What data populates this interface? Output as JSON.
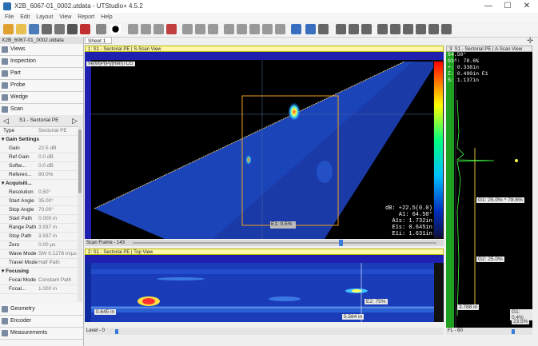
{
  "window": {
    "title": "X2B_6067-01_0002.utdata - UTStudio+ 4.5.2",
    "minimize": "—",
    "maximize": "☐",
    "close": "✕"
  },
  "menu": [
    "File",
    "Edit",
    "Layout",
    "View",
    "Report",
    "Help"
  ],
  "left": {
    "file": "X2B_6067-01_0002.utdata",
    "nav_top": [
      "Views",
      "Inspection",
      "Part",
      "Probe",
      "Wedge",
      "Scan"
    ],
    "selector": "S1 - Sectorial PE",
    "type_key": "Type",
    "type_val": "Sectorial PE",
    "groups": {
      "gain": "Gain Settings",
      "acq": "Acquisiti...",
      "focus": "Focusing"
    },
    "gain_rows": [
      {
        "k": "Gain",
        "v": "22.5 dB"
      },
      {
        "k": "Ref Gain",
        "v": "0.0 dB"
      },
      {
        "k": "Softw...",
        "v": "0.0 dB"
      },
      {
        "k": "Referen...",
        "v": "80.0%"
      }
    ],
    "acq_rows": [
      {
        "k": "Resolution",
        "v": "0.50°"
      },
      {
        "k": "Start Angle",
        "v": "35.00°"
      },
      {
        "k": "Stop Angle",
        "v": "70.00°"
      },
      {
        "k": "Start Path",
        "v": "0.000 in"
      },
      {
        "k": "Range Path",
        "v": "3.937 in"
      },
      {
        "k": "Stop Path",
        "v": "3.937 in"
      },
      {
        "k": "Zero",
        "v": "0.00 µs"
      },
      {
        "k": "Wave Mode",
        "v": "SW 0.1278 in/µs"
      },
      {
        "k": "Travel Mode",
        "v": "Half Path"
      }
    ],
    "focus_rows": [
      {
        "k": "Focal Mode",
        "v": "Constant Path"
      },
      {
        "k": "Focal...",
        "v": "1.000 in"
      }
    ],
    "nav_bottom": [
      "Geometry",
      "Encoder",
      "Measurements"
    ]
  },
  "sheet": "Sheet 1",
  "sscan": {
    "title": "1: S1 - Sectorial PE | S-Scan View",
    "toolbar": [
      "Ve",
      "W",
      "Pl",
      "Py",
      "Ren",
      "TCG"
    ],
    "top_ticks": [
      "0",
      "0.25",
      "0.5",
      "0.75",
      "1",
      "1.25",
      "1.5",
      "1.75",
      "2",
      "2.25",
      "2.5",
      "2.75"
    ],
    "left_ticks": [
      "0",
      "0.25",
      "0.5",
      "0.75",
      "1",
      "1.25",
      "1.5",
      "1.75",
      "2"
    ],
    "readout": [
      "dB: +22.5(0.0)",
      "A1: 64.50°",
      "A1s: 1.732in",
      "E1s: 0.645in",
      "E1i: 1.631in"
    ],
    "cursor_label": "E1: 0.5%",
    "scan_frame": "Scan Frame - 143"
  },
  "ascan": {
    "title": "3: S1 - Sectorial PE | A-Scan View",
    "readout": [
      "64.50°",
      "G1^: 78.6%",
      "+: 0.338in",
      "Σ: 0.490in E1",
      "S: 1.137in"
    ],
    "gate1": "G1: 25.0% ^ 78.6%",
    "gate2": "G2: 25.0%",
    "bottom_left": "3.788 in",
    "bottom_right": "G1: 0.4%",
    "bottom_right2": "23.5%",
    "fl": "FL - 60"
  },
  "topview": {
    "title": "2: S1 - Sectorial PE | Top View",
    "ticks": [
      "0",
      "0.5",
      "1",
      "1.5",
      "2",
      "2.5",
      "3",
      "3.5",
      "4",
      "4.5",
      "5",
      "5.5",
      "6",
      "6.5",
      "7"
    ],
    "left_label": "0.645 in",
    "cursor_label": "E2: 75%",
    "bottom_label": "5.584 in",
    "level": "Level - 0"
  },
  "colors": {
    "accent": "#fff8a8",
    "brand": "#2a6fb0"
  }
}
